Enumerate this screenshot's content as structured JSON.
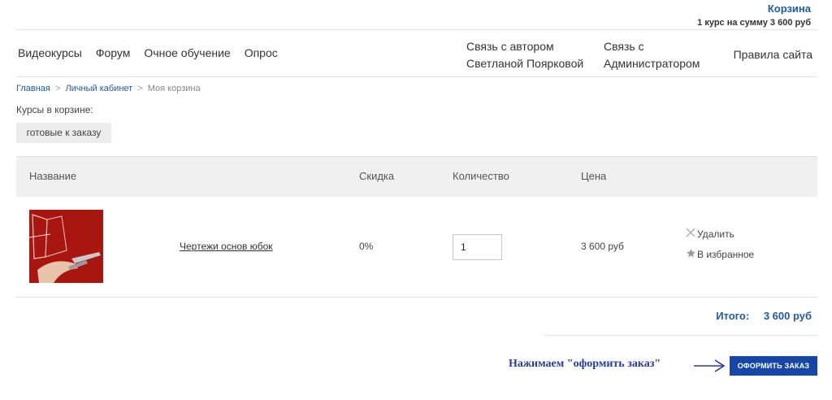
{
  "cart_summary": {
    "title": "Корзина",
    "total_text": "1 курс на сумму 3 600 руб"
  },
  "nav": {
    "left": [
      "Видеокурсы",
      "Форум",
      "Очное обучение",
      "Опрос"
    ],
    "contact_author_line1": "Связь с автором",
    "contact_author_line2": "Светланой Поярковой",
    "contact_admin_line1": "Связь с",
    "contact_admin_line2": "Администратором",
    "rules": "Правила сайта"
  },
  "breadcrumb": {
    "home": "Главная",
    "cabinet": "Личный кабинет",
    "current": "Моя корзина",
    "separator": ">"
  },
  "cart": {
    "heading": "Курсы в корзине:",
    "tab_ready": "готовые к заказу"
  },
  "table": {
    "headers": {
      "name": "Название",
      "discount": "Скидка",
      "quantity": "Количество",
      "price": "Цена"
    },
    "rows": [
      {
        "title": "Чертежи основ юбок",
        "discount": "0%",
        "quantity": "1",
        "price": "3 600 руб",
        "delete_label": "Удалить",
        "favorite_label": "В избранное"
      }
    ]
  },
  "total": {
    "label": "Итого:",
    "value": "3 600 руб"
  },
  "order": {
    "hint": "Нажимаем \"оформить заказ\"",
    "button_label": "ОФОРМИТЬ ЗАКАЗ"
  },
  "colors": {
    "link_blue": "#1f5aa6",
    "button_blue": "#1747a6",
    "hint_blue": "#2a3aa8",
    "thumb_red": "#b51a12"
  },
  "icons": {
    "delete": "close-icon",
    "favorite": "star-icon",
    "hint_arrow": "arrow-right-icon"
  }
}
